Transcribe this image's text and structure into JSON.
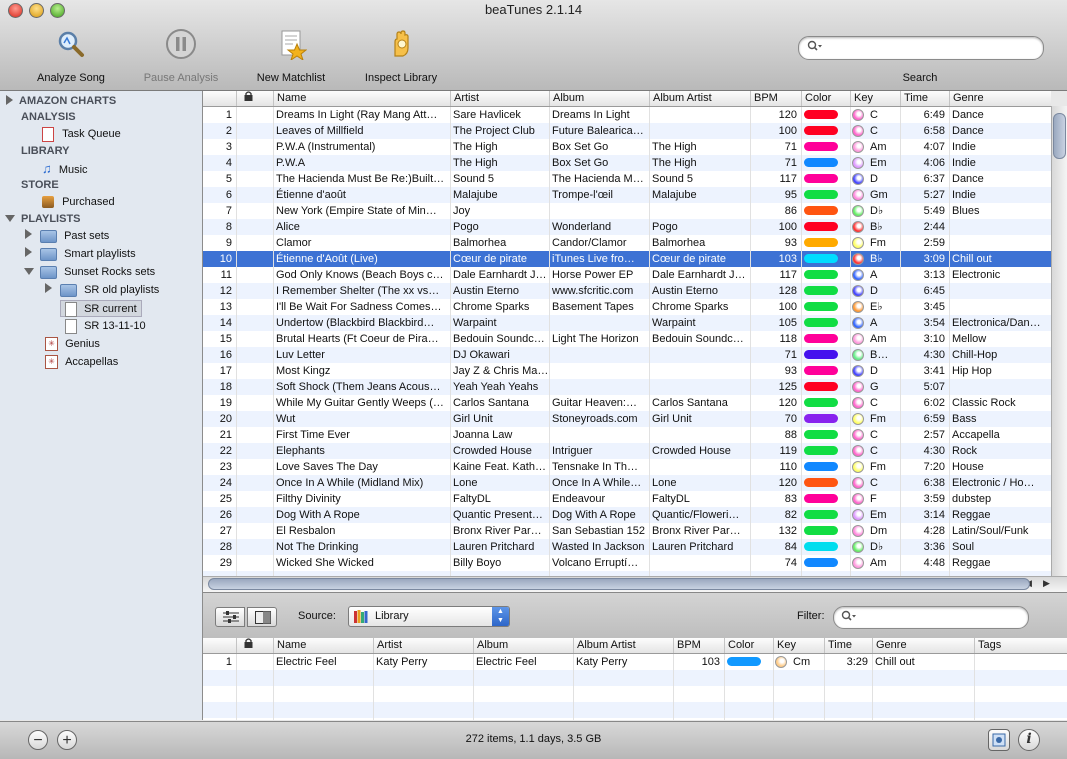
{
  "window": {
    "title": "beaTunes 2.1.14"
  },
  "colors": {
    "selection": "#3d72d4",
    "row_alt": "#edf3fe"
  },
  "toolbar": {
    "analyze_label": "Analyze Song",
    "pause_label": "Pause Analysis",
    "matchlist_label": "New Matchlist",
    "inspect_label": "Inspect Library",
    "search_label": "Search",
    "search_placeholder": ""
  },
  "sidebar": {
    "amazon": "AMAZON CHARTS",
    "analysis": "ANALYSIS",
    "task_queue": "Task Queue",
    "library": "LIBRARY",
    "music": "Music",
    "store": "STORE",
    "purchased": "Purchased",
    "playlists": "PLAYLISTS",
    "past_sets": "Past sets",
    "smart_playlists": "Smart playlists",
    "sunset_rocks": "Sunset Rocks sets",
    "sr_old": "SR old playlists",
    "sr_current": "SR current",
    "sr_date": "SR 13-11-10",
    "genius": "Genius",
    "accapellas": "Accapellas"
  },
  "columns": {
    "name": "Name",
    "artist": "Artist",
    "album": "Album",
    "album_artist": "Album Artist",
    "bpm": "BPM",
    "color": "Color",
    "key": "Key",
    "time": "Time",
    "genre": "Genre",
    "tags": "Tags"
  },
  "tracks": [
    {
      "n": "1",
      "name": "Dreams In Light (Ray Mang Att…",
      "artist": "Sare Havlicek",
      "album": "Dreams In Light",
      "album_artist": "",
      "bpm": "120",
      "color": "#ff0022",
      "key": "C",
      "keycolor": "#ff66cc",
      "time": "6:49",
      "genre": "Dance"
    },
    {
      "n": "2",
      "name": "Leaves of Millfield",
      "artist": "The Project Club",
      "album": "Future Balearica…",
      "album_artist": "",
      "bpm": "100",
      "color": "#ff0022",
      "key": "C",
      "keycolor": "#ff66cc",
      "time": "6:58",
      "genre": "Dance"
    },
    {
      "n": "3",
      "name": "P.W.A (Instrumental)",
      "artist": "The High",
      "album": "Box Set Go",
      "album_artist": "The High",
      "bpm": "71",
      "color": "#ff0099",
      "key": "Am",
      "keycolor": "#ff99dd",
      "time": "4:07",
      "genre": "Indie"
    },
    {
      "n": "4",
      "name": "P.W.A",
      "artist": "The High",
      "album": "Box Set Go",
      "album_artist": "The High",
      "bpm": "71",
      "color": "#1188ff",
      "key": "Em",
      "keycolor": "#dd99ff",
      "time": "4:06",
      "genre": "Indie"
    },
    {
      "n": "5",
      "name": "The Hacienda Must Be Re:)Built…",
      "artist": "Sound 5",
      "album": "The Hacienda M…",
      "album_artist": "Sound 5",
      "bpm": "117",
      "color": "#ff0099",
      "key": "D",
      "keycolor": "#4444ff",
      "time": "6:37",
      "genre": "Dance"
    },
    {
      "n": "6",
      "name": "Étienne d'août",
      "artist": "Malajube",
      "album": "Trompe-l'œil",
      "album_artist": "Malajube",
      "bpm": "95",
      "color": "#11dd44",
      "key": "Gm",
      "keycolor": "#ff88dd",
      "time": "5:27",
      "genre": "Indie"
    },
    {
      "n": "7",
      "name": "New York (Empire State of Min…",
      "artist": "Joy",
      "album": "",
      "album_artist": "",
      "bpm": "86",
      "color": "#ff5511",
      "key": "D♭",
      "keycolor": "#66ee66",
      "time": "5:49",
      "genre": "Blues"
    },
    {
      "n": "8",
      "name": "Alice",
      "artist": "Pogo",
      "album": "Wonderland",
      "album_artist": "Pogo",
      "bpm": "100",
      "color": "#ff0022",
      "key": "B♭",
      "keycolor": "#ff3333",
      "time": "2:44",
      "genre": ""
    },
    {
      "n": "9",
      "name": "Clamor",
      "artist": "Balmorhea",
      "album": "Candor/Clamor",
      "album_artist": "Balmorhea",
      "bpm": "93",
      "color": "#ffaa00",
      "key": "Fm",
      "keycolor": "#ffff66",
      "time": "2:59",
      "genre": ""
    },
    {
      "n": "10",
      "name": "Étienne d'Août (Live)",
      "artist": "Cœur de pirate",
      "album": "iTunes Live fro…",
      "album_artist": "Cœur de pirate",
      "bpm": "103",
      "color": "#00ddff",
      "key": "B♭",
      "keycolor": "#ff3333",
      "time": "3:09",
      "genre": "Chill out"
    },
    {
      "n": "11",
      "name": "God Only Knows (Beach Boys c…",
      "artist": "Dale Earnhardt J…",
      "album": "Horse Power EP",
      "album_artist": "Dale Earnhardt J…",
      "bpm": "117",
      "color": "#11dd44",
      "key": "A",
      "keycolor": "#3366ff",
      "time": "3:13",
      "genre": "Electronic"
    },
    {
      "n": "12",
      "name": "I Remember Shelter (The xx vs…",
      "artist": "Austin Eterno",
      "album": "www.sfcritic.com",
      "album_artist": "Austin Eterno",
      "bpm": "128",
      "color": "#11dd44",
      "key": "D",
      "keycolor": "#4444ff",
      "time": "6:45",
      "genre": ""
    },
    {
      "n": "13",
      "name": "I'll Be Wait For Sadness Comes…",
      "artist": "Chrome Sparks",
      "album": "Basement Tapes",
      "album_artist": "Chrome Sparks",
      "bpm": "100",
      "color": "#11dd44",
      "key": "E♭",
      "keycolor": "#ff9933",
      "time": "3:45",
      "genre": ""
    },
    {
      "n": "14",
      "name": "Undertow (Blackbird Blackbird…",
      "artist": "Warpaint",
      "album": "",
      "album_artist": "Warpaint",
      "bpm": "105",
      "color": "#11dd44",
      "key": "A",
      "keycolor": "#3366ff",
      "time": "3:54",
      "genre": "Electronica/Dan…"
    },
    {
      "n": "15",
      "name": "Brutal Hearts (Ft Coeur de Pira…",
      "artist": "Bedouin Soundc…",
      "album": "Light The Horizon",
      "album_artist": "Bedouin Soundc…",
      "bpm": "118",
      "color": "#ff0099",
      "key": "Am",
      "keycolor": "#ff99dd",
      "time": "3:10",
      "genre": "Mellow"
    },
    {
      "n": "16",
      "name": "Luv Letter",
      "artist": "DJ Okawari",
      "album": "",
      "album_artist": "",
      "bpm": "71",
      "color": "#4411ee",
      "key": "B…",
      "keycolor": "#66ee88",
      "time": "4:30",
      "genre": "Chill-Hop"
    },
    {
      "n": "17",
      "name": "Most Kingz",
      "artist": "Jay Z & Chris Ma…",
      "album": "",
      "album_artist": "",
      "bpm": "93",
      "color": "#ff0099",
      "key": "D",
      "keycolor": "#4444ff",
      "time": "3:41",
      "genre": "Hip Hop"
    },
    {
      "n": "18",
      "name": "Soft Shock (Them Jeans Acous…",
      "artist": "Yeah Yeah Yeahs",
      "album": "",
      "album_artist": "",
      "bpm": "125",
      "color": "#ff0022",
      "key": "G",
      "keycolor": "#ff66cc",
      "time": "5:07",
      "genre": ""
    },
    {
      "n": "19",
      "name": "While My Guitar Gently Weeps (…",
      "artist": "Carlos Santana",
      "album": "Guitar Heaven:…",
      "album_artist": "Carlos Santana",
      "bpm": "120",
      "color": "#11dd44",
      "key": "C",
      "keycolor": "#ff66cc",
      "time": "6:02",
      "genre": "Classic Rock"
    },
    {
      "n": "20",
      "name": "Wut",
      "artist": "Girl Unit",
      "album": "Stoneyroads.com",
      "album_artist": "Girl Unit",
      "bpm": "70",
      "color": "#8822ee",
      "key": "Fm",
      "keycolor": "#ffff66",
      "time": "6:59",
      "genre": "Bass"
    },
    {
      "n": "21",
      "name": "First Time Ever",
      "artist": "Joanna Law",
      "album": "",
      "album_artist": "",
      "bpm": "88",
      "color": "#11dd44",
      "key": "C",
      "keycolor": "#ff66cc",
      "time": "2:57",
      "genre": "Accapella"
    },
    {
      "n": "22",
      "name": "Elephants",
      "artist": "Crowded House",
      "album": "Intriguer",
      "album_artist": "Crowded House",
      "bpm": "119",
      "color": "#11dd44",
      "key": "C",
      "keycolor": "#ff66cc",
      "time": "4:30",
      "genre": "Rock"
    },
    {
      "n": "23",
      "name": "Love Saves The Day",
      "artist": "Kaine Feat. Kath…",
      "album": "Tensnake In Th…",
      "album_artist": "",
      "bpm": "110",
      "color": "#1188ff",
      "key": "Fm",
      "keycolor": "#ffff66",
      "time": "7:20",
      "genre": "House"
    },
    {
      "n": "24",
      "name": "Once In A While (Midland Mix)",
      "artist": "Lone",
      "album": "Once In A While…",
      "album_artist": "Lone",
      "bpm": "120",
      "color": "#ff5511",
      "key": "C",
      "keycolor": "#ff66cc",
      "time": "6:38",
      "genre": "Electronic / Ho…"
    },
    {
      "n": "25",
      "name": "Filthy Divinity",
      "artist": "FaltyDL",
      "album": "Endeavour",
      "album_artist": "FaltyDL",
      "bpm": "83",
      "color": "#ff0099",
      "key": "F",
      "keycolor": "#ff66cc",
      "time": "3:59",
      "genre": "dubstep"
    },
    {
      "n": "26",
      "name": "Dog With A Rope",
      "artist": "Quantic Present…",
      "album": "Dog With A Rope",
      "album_artist": "Quantic/Floweri…",
      "bpm": "82",
      "color": "#11dd44",
      "key": "Em",
      "keycolor": "#dd99ff",
      "time": "3:14",
      "genre": "Reggae"
    },
    {
      "n": "27",
      "name": "El Resbalon",
      "artist": "Bronx River Par…",
      "album": "San Sebastian 152",
      "album_artist": "Bronx River Par…",
      "bpm": "132",
      "color": "#11dd44",
      "key": "Dm",
      "keycolor": "#ff88dd",
      "time": "4:28",
      "genre": "Latin/Soul/Funk"
    },
    {
      "n": "28",
      "name": "Not The Drinking",
      "artist": "Lauren Pritchard",
      "album": "Wasted In Jackson",
      "album_artist": "Lauren Pritchard",
      "bpm": "84",
      "color": "#00ddee",
      "key": "D♭",
      "keycolor": "#66ee66",
      "time": "3:36",
      "genre": "Soul"
    },
    {
      "n": "29",
      "name": "Wicked She Wicked",
      "artist": "Billy Boyo",
      "album": "Volcano Erruptí…",
      "album_artist": "",
      "bpm": "74",
      "color": "#1188ff",
      "key": "Am",
      "keycolor": "#ff99dd",
      "time": "4:48",
      "genre": "Reggae"
    }
  ],
  "panel": {
    "source_label": "Source:",
    "source_value": "Library",
    "filter_label": "Filter:",
    "filter_placeholder": ""
  },
  "matches": [
    {
      "n": "1",
      "name": "Electric Feel",
      "artist": "Katy Perry",
      "album": "Electric Feel",
      "album_artist": "Katy Perry",
      "bpm": "103",
      "color": "#1199ff",
      "key": "Cm",
      "keycolor": "#ffcc88",
      "time": "3:29",
      "genre": "Chill out",
      "tags": ""
    }
  ],
  "status": {
    "summary": "272 items, 1.1 days, 3.5 GB",
    "remove": "−",
    "add": "+",
    "info": "i"
  }
}
